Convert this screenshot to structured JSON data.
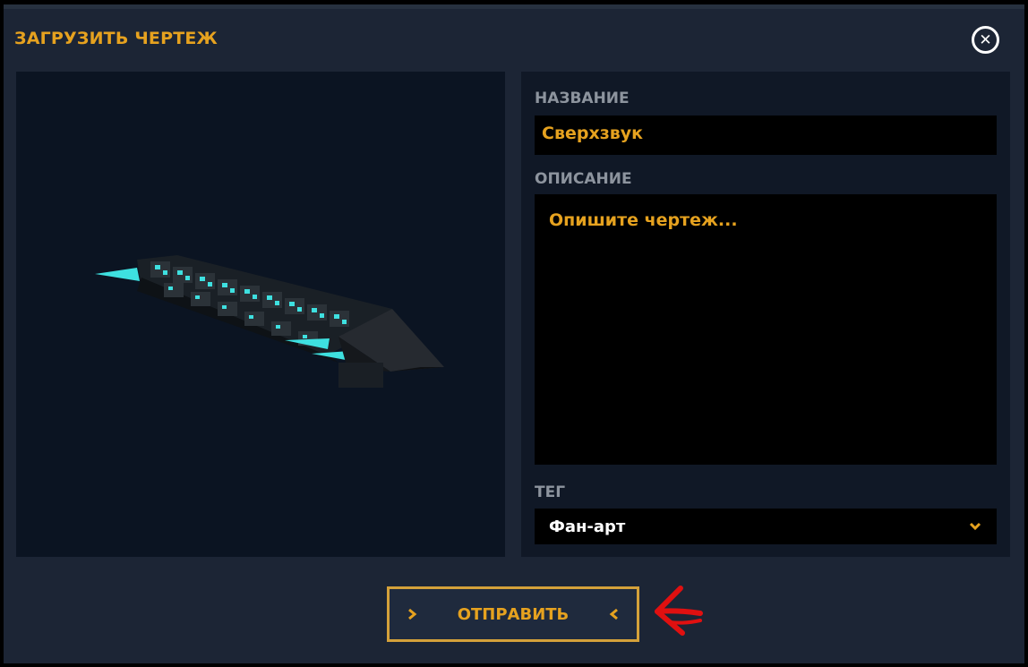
{
  "dialog": {
    "title": "ЗАГРУЗИТЬ ЧЕРТЕЖ",
    "close_icon": "close-icon"
  },
  "preview": {
    "icon": "spaceship-model-image"
  },
  "form": {
    "name_label": "НАЗВАНИЕ",
    "name_value": "Сверхзвук",
    "description_label": "ОПИСАНИЕ",
    "description_placeholder": "Опишите чертеж...",
    "tag_label": "ТЕГ",
    "tag_value": "Фан-арт",
    "tag_icon": "chevron-down-icon"
  },
  "submit": {
    "label": "ОТПРАВИТЬ",
    "left_icon": "chevron-right-icon",
    "right_icon": "chevron-left-icon"
  },
  "annotation": {
    "icon": "red-arrow-left-icon"
  },
  "colors": {
    "accent": "#e6a21f",
    "panel": "#1c2535",
    "field": "#000000",
    "preview_bg": "#0b1422",
    "annotation": "#e01010"
  }
}
